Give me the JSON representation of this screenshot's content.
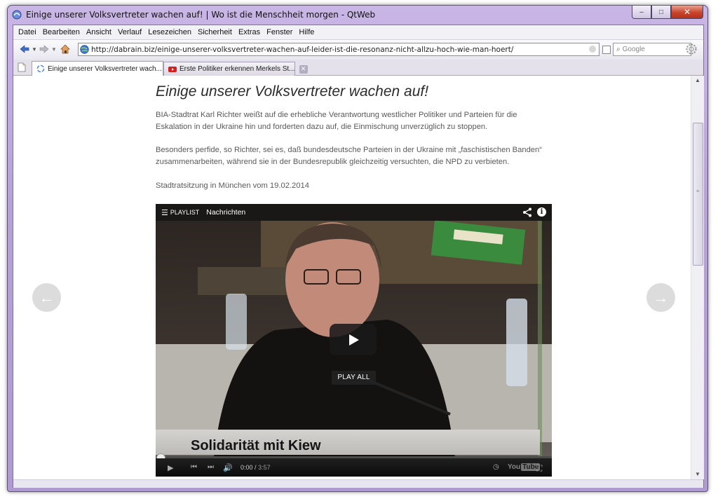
{
  "window": {
    "title": "Einige unserer Volksvertreter wachen auf! | Wo ist die Menschheit morgen - QtWeb",
    "controls": {
      "minimize": "–",
      "maximize": "□",
      "close": "✕"
    }
  },
  "menu": [
    "Datei",
    "Bearbeiten",
    "Ansicht",
    "Verlauf",
    "Lesezeichen",
    "Sicherheit",
    "Extras",
    "Fenster",
    "Hilfe"
  ],
  "navbar": {
    "url": "http://dabrain.biz/einige-unserer-volksvertreter-wachen-auf-leider-ist-die-resonanz-nicht-allzu-hoch-wie-man-hoert/",
    "search_placeholder": "Google"
  },
  "tabs": [
    {
      "label": "Einige unserer Volksvertreter wach...",
      "active": true
    },
    {
      "label": "Erste Politiker erkennen Merkels St...",
      "active": false
    }
  ],
  "article": {
    "title": "Einige unserer Volksvertreter wachen auf!",
    "paragraphs": [
      "BIA-Stadtrat Karl Richter weißt auf die erhebliche Verantwortung westlicher Politiker und Parteien für die Eskalation in der Ukraine hin und forderten dazu auf, die Einmischung unverzüglich zu stoppen.",
      "Besonders perfide, so Richter, sei es, daß bundesdeutsche Parteien in der Ukraine mit „faschistischen Banden“ zusammenarbeiten, während sie in der Bundesrepublik gleichzeitig versuchten, die NPD zu verbieten.",
      "Stadtratsitzung in München vom 19.02.2014"
    ]
  },
  "video": {
    "playlist_label": "PLAYLIST",
    "playlist_name": "Nachrichten",
    "play_all": "PLAY ALL",
    "caption": "Solidarität mit Kiew",
    "time_current": "0:00",
    "time_total": "3:57",
    "progress": 0,
    "logo": "You",
    "logo_box": "Tube"
  },
  "colors": {
    "frame": "#b7a2d6",
    "close_button": "#c8452c",
    "tab_close_active": "#e0542d",
    "youtube_red": "#d42020"
  }
}
